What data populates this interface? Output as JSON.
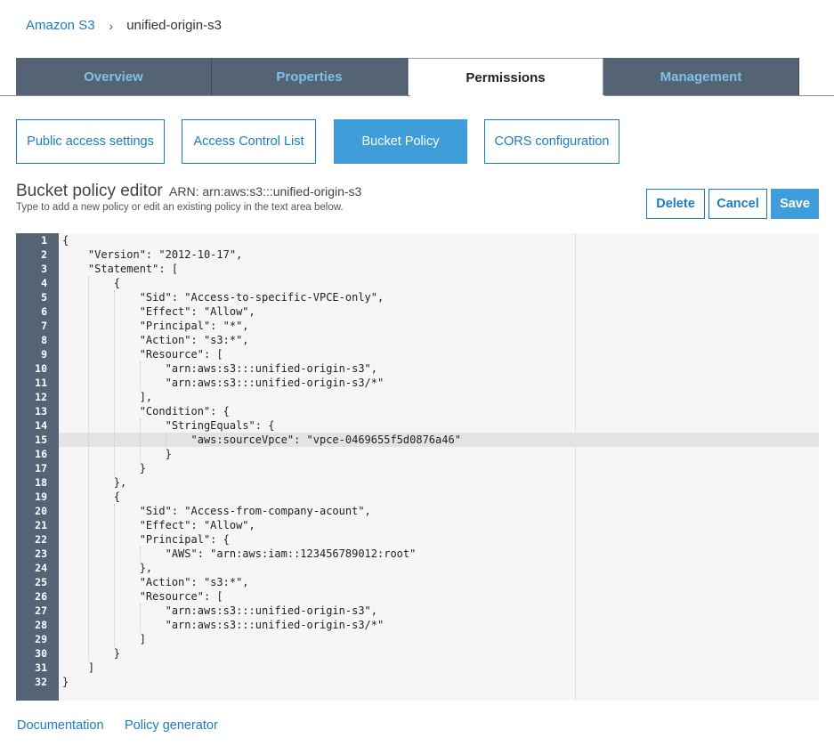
{
  "breadcrumb": {
    "root": "Amazon S3",
    "separator": "›",
    "current": "unified-origin-s3"
  },
  "tabs": [
    {
      "label": "Overview",
      "active": false
    },
    {
      "label": "Properties",
      "active": false
    },
    {
      "label": "Permissions",
      "active": true
    },
    {
      "label": "Management",
      "active": false
    }
  ],
  "subtabs": [
    {
      "label": "Public access settings",
      "active": false
    },
    {
      "label": "Access Control List",
      "active": false
    },
    {
      "label": "Bucket Policy",
      "active": true
    },
    {
      "label": "CORS configuration",
      "active": false
    }
  ],
  "editor": {
    "title": "Bucket policy editor",
    "arn": "ARN: arn:aws:s3:::unified-origin-s3",
    "help": "Type to add a new policy or edit an existing policy in the text area below.",
    "highlighted_line": 15,
    "lines": [
      "{",
      "    \"Version\": \"2012-10-17\",",
      "    \"Statement\": [",
      "        {",
      "            \"Sid\": \"Access-to-specific-VPCE-only\",",
      "            \"Effect\": \"Allow\",",
      "            \"Principal\": \"*\",",
      "            \"Action\": \"s3:*\",",
      "            \"Resource\": [",
      "                \"arn:aws:s3:::unified-origin-s3\",",
      "                \"arn:aws:s3:::unified-origin-s3/*\"",
      "            ],",
      "            \"Condition\": {",
      "                \"StringEquals\": {",
      "                    \"aws:sourceVpce\": \"vpce-0469655f5d0876a46\"",
      "                }",
      "            }",
      "        },",
      "        {",
      "            \"Sid\": \"Access-from-company-acount\",",
      "            \"Effect\": \"Allow\",",
      "            \"Principal\": {",
      "                \"AWS\": \"arn:aws:iam::123456789012:root\"",
      "            },",
      "            \"Action\": \"s3:*\",",
      "            \"Resource\": [",
      "                \"arn:aws:s3:::unified-origin-s3\",",
      "                \"arn:aws:s3:::unified-origin-s3/*\"",
      "            ]",
      "        }",
      "    ]",
      "}"
    ]
  },
  "actions": {
    "delete": "Delete",
    "cancel": "Cancel",
    "save": "Save"
  },
  "footer": {
    "documentation": "Documentation",
    "policy_generator": "Policy generator"
  },
  "colors": {
    "accent": "#1a7dc4",
    "primary_button": "#3f9ed9",
    "tab_bar": "#546474",
    "tab_text": "#7fc0ea",
    "gutter": "#546474"
  }
}
